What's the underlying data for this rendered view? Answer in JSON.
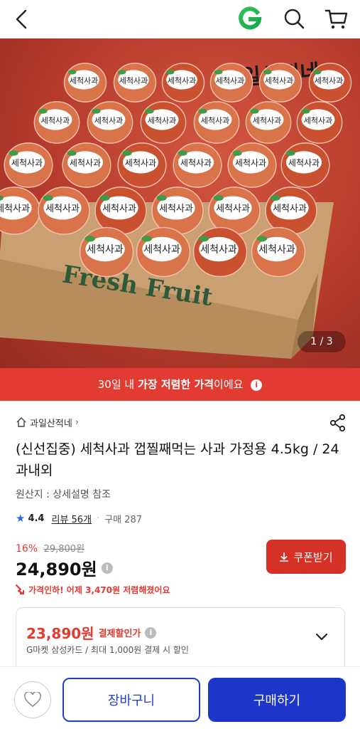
{
  "header": {
    "back_icon": "chevron-left-icon",
    "logo_icon": "gmarket-g-logo",
    "search_icon": "search-icon",
    "cart_icon": "cart-icon"
  },
  "hero": {
    "brand_text": "과일산적네",
    "box_text": "Fresh Fruit",
    "label_text": "세척사과",
    "counter": "1 / 3"
  },
  "banner": {
    "prefix": "30일 내",
    "emphasis": "가장 저렴한 가격",
    "suffix": "이에요"
  },
  "product": {
    "seller": "과일산적네",
    "title": "(신선집중) 세척사과 껍찔째먹는 사과 가정용 4.5kg / 24과내외",
    "origin": "원산지 : 상세설명 참조",
    "rating": "4.4",
    "review": "리뷰 56개",
    "purchases": "구매 287",
    "discount_rate": "16%",
    "original_price": "29,800원",
    "price": "24,890원",
    "coupon_button": "쿠폰받기",
    "price_drop": "가격인하! 어제 3,470원 저렴해졌어요"
  },
  "card_discount": {
    "price": "23,890원",
    "label": "결제할인가",
    "desc": "G마켓 삼성카드 / 최대 1,000원 결제 시 할인"
  },
  "bottom_bar": {
    "cart_label": "장바구니",
    "buy_label": "구매하기"
  },
  "colors": {
    "accent_red": "#e23b31",
    "primary_blue": "#1d36c9",
    "rating_star": "#2f66e8"
  }
}
